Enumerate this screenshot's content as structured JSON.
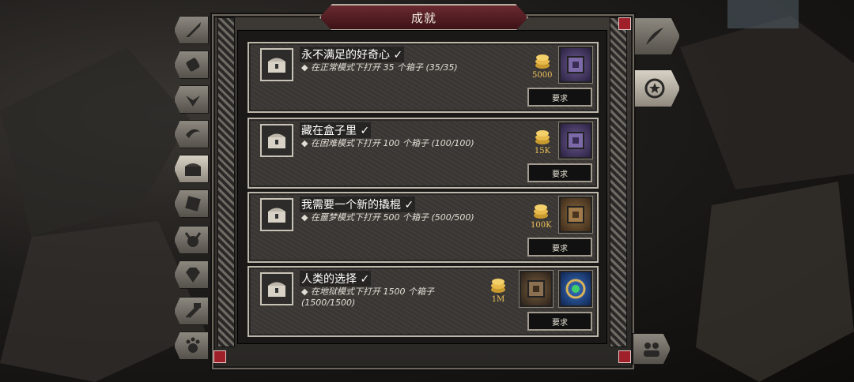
{
  "window": {
    "title": "成就"
  },
  "achievements": [
    {
      "name": "永不满足的好奇心 ✓",
      "desc": "◆ 在正常模式下打开 35 个箱子 (35/35)",
      "reward": "5000",
      "button": "要求",
      "slot_colors": [
        "#3b2f55"
      ]
    },
    {
      "name": "藏在盒子里 ✓",
      "desc": "◆ 在困难模式下打开 100 个箱子 (100/100)",
      "reward": "15K",
      "button": "要求",
      "slot_colors": [
        "#3b2f55"
      ]
    },
    {
      "name": "我需要一个新的撬棍 ✓",
      "desc": "◆ 在噩梦模式下打开 500 个箱子 (500/500)",
      "reward": "100K",
      "button": "要求",
      "slot_colors": [
        "#5a3a22"
      ]
    },
    {
      "name": "人类的选择 ✓",
      "desc": "◆ 在地狱模式下打开 1500 个箱子 (1500/1500)",
      "reward": "1M",
      "button": "要求",
      "slot_colors": [
        "#4a3a28",
        "#1f3f7a"
      ]
    }
  ],
  "left_tabs": [
    "sword-icon",
    "scroll-icon",
    "wings-icon",
    "swoosh-icon",
    "chest-icon",
    "gem-box-icon",
    "horned-skull-icon",
    "diamond-icon",
    "hammers-icon",
    "paw-icon"
  ],
  "right_tabs": [
    "feather-icon",
    "laurel-star-icon"
  ],
  "colors": {
    "accent": "#6a2a30",
    "gold": "#f0c35a",
    "frame": "#bdb6ab"
  }
}
